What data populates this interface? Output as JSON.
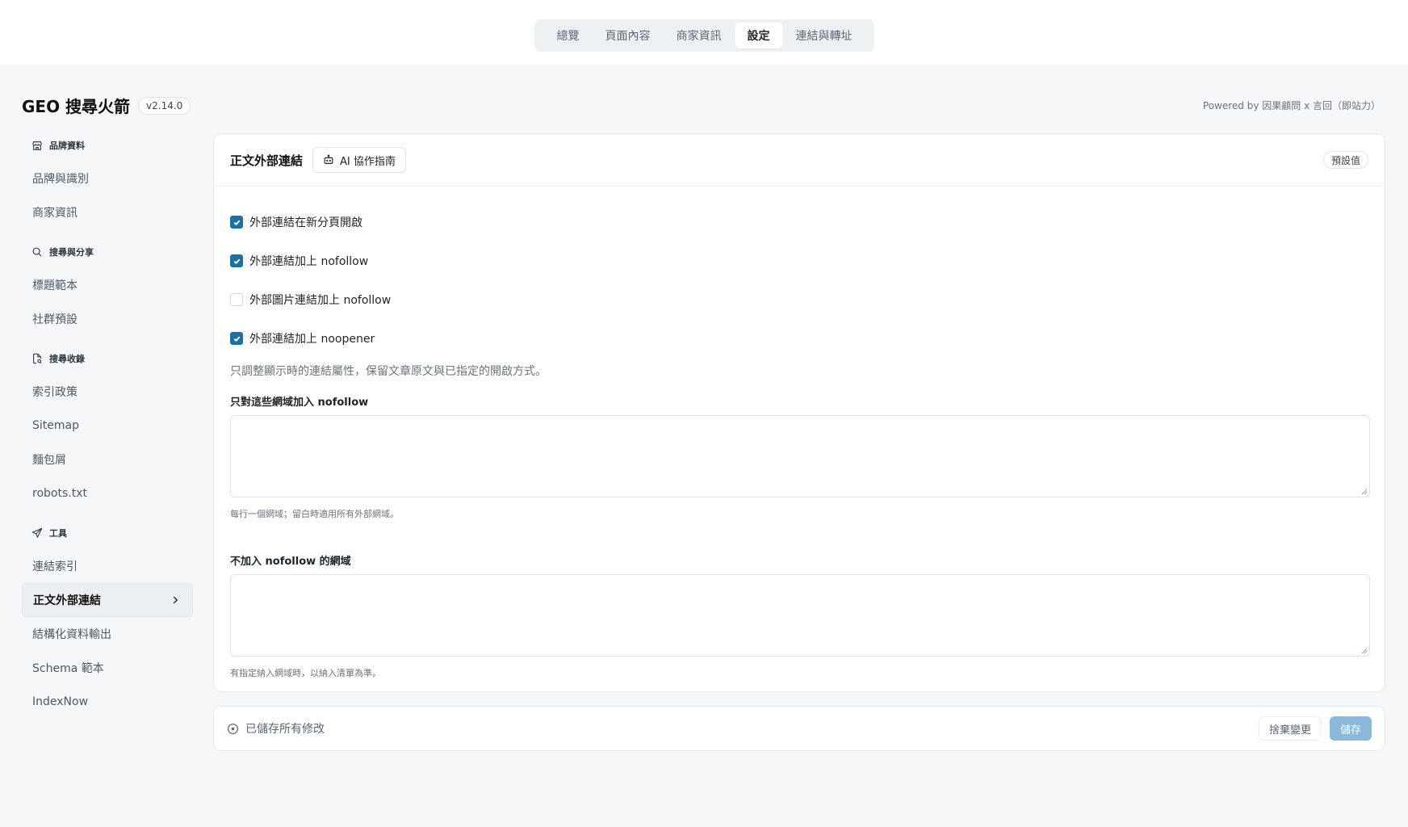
{
  "tabs": [
    {
      "label": "總覽",
      "active": false
    },
    {
      "label": "頁面內容",
      "active": false
    },
    {
      "label": "商家資訊",
      "active": false
    },
    {
      "label": "設定",
      "active": true
    },
    {
      "label": "連結與轉址",
      "active": false
    }
  ],
  "header": {
    "title": "GEO 搜尋火箭",
    "version": "v2.14.0",
    "powered_by": "Powered by 因果顧問 x 言回（即站力）"
  },
  "sidebar": {
    "sections": [
      {
        "title": "品牌資料",
        "icon": "store-icon",
        "items": [
          "品牌與識別",
          "商家資訊"
        ]
      },
      {
        "title": "搜尋與分享",
        "icon": "search-icon",
        "items": [
          "標題範本",
          "社群預設"
        ]
      },
      {
        "title": "搜尋收錄",
        "icon": "file-search-icon",
        "items": [
          "索引政策",
          "Sitemap",
          "麵包屑",
          "robots.txt"
        ]
      },
      {
        "title": "工具",
        "icon": "send-icon",
        "items": [
          "連結索引",
          "正文外部連結",
          "結構化資料輸出",
          "Schema 範本",
          "IndexNow"
        ]
      }
    ],
    "active_item": "正文外部連結"
  },
  "card": {
    "title": "正文外部連結",
    "ai_button": "AI 協作指南",
    "default_button": "預設值",
    "checkboxes": [
      {
        "label": "外部連結在新分頁開啟",
        "checked": true
      },
      {
        "label": "外部連結加上 nofollow",
        "checked": true
      },
      {
        "label": "外部圖片連結加上 nofollow",
        "checked": false
      },
      {
        "label": "外部連結加上 noopener",
        "checked": true
      }
    ],
    "hint": "只調整顯示時的連結屬性，保留文章原文與已指定的開啟方式。",
    "include_label": "只對這些網域加入 nofollow",
    "include_value": "",
    "include_hint": "每行一個網域；留白時適用所有外部網域。",
    "exclude_label": "不加入 nofollow 的網域",
    "exclude_value": "",
    "exclude_hint": "有指定納入網域時，以納入清單為準。"
  },
  "footer": {
    "status": "已儲存所有修改",
    "discard": "捨棄變更",
    "save": "儲存"
  },
  "colors": {
    "accent": "#1d6fa5",
    "save_disabled": "#8bb8d9"
  }
}
